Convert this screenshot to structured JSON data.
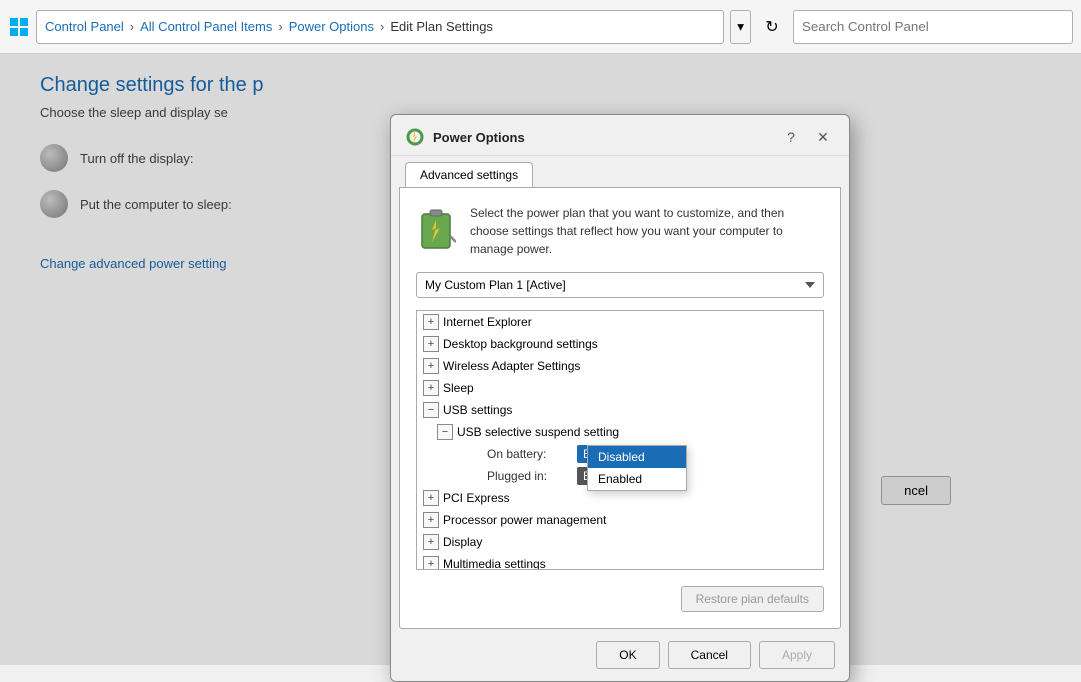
{
  "addressBar": {
    "breadcrumbs": [
      {
        "label": "Control Panel",
        "clickable": true
      },
      {
        "label": "All Control Panel Items",
        "clickable": true
      },
      {
        "label": "Power Options",
        "clickable": true
      },
      {
        "label": "Edit Plan Settings",
        "clickable": false
      }
    ],
    "searchPlaceholder": "Search Control Panel"
  },
  "mainContent": {
    "title": "Change settings for the p",
    "subtitle": "Choose the sleep and display se",
    "settings": [
      {
        "label": "Turn off the display:",
        "hasIcon": true
      },
      {
        "label": "Put the computer to sleep:",
        "hasIcon": true
      }
    ],
    "changeLink": "Change advanced power setting"
  },
  "backgroundButton": {
    "label": "ncel"
  },
  "dialog": {
    "title": "Power Options",
    "helpLabel": "?",
    "closeLabel": "✕",
    "tab": "Advanced settings",
    "description": "Select the power plan that you want to customize, and then choose settings that reflect how you want your computer to manage power.",
    "planDropdownValue": "My Custom Plan 1 [Active]",
    "treeItems": [
      {
        "indent": 0,
        "expand": "+",
        "label": "Internet Explorer"
      },
      {
        "indent": 0,
        "expand": "+",
        "label": "Desktop background settings"
      },
      {
        "indent": 0,
        "expand": "+",
        "label": "Wireless Adapter Settings"
      },
      {
        "indent": 0,
        "expand": "+",
        "label": "Sleep"
      },
      {
        "indent": 0,
        "expand": "-",
        "label": "USB settings"
      },
      {
        "indent": 1,
        "expand": "-",
        "label": "USB selective suspend setting"
      },
      {
        "indent": 0,
        "expand": "+",
        "label": "PCI Express"
      },
      {
        "indent": 0,
        "expand": "+",
        "label": "Processor power management"
      },
      {
        "indent": 0,
        "expand": "+",
        "label": "Display"
      },
      {
        "indent": 0,
        "expand": "+",
        "label": "Multimedia settings"
      }
    ],
    "onBatteryLabel": "On battery:",
    "onBatteryValue": "Enabled",
    "pluggedInLabel": "Plugged in:",
    "dropdownOptions": [
      {
        "label": "Disabled",
        "highlighted": true
      },
      {
        "label": "Enabled",
        "highlighted": false
      }
    ],
    "restoreBtnLabel": "Restore plan defaults",
    "footer": {
      "okLabel": "OK",
      "cancelLabel": "Cancel",
      "applyLabel": "Apply"
    }
  }
}
